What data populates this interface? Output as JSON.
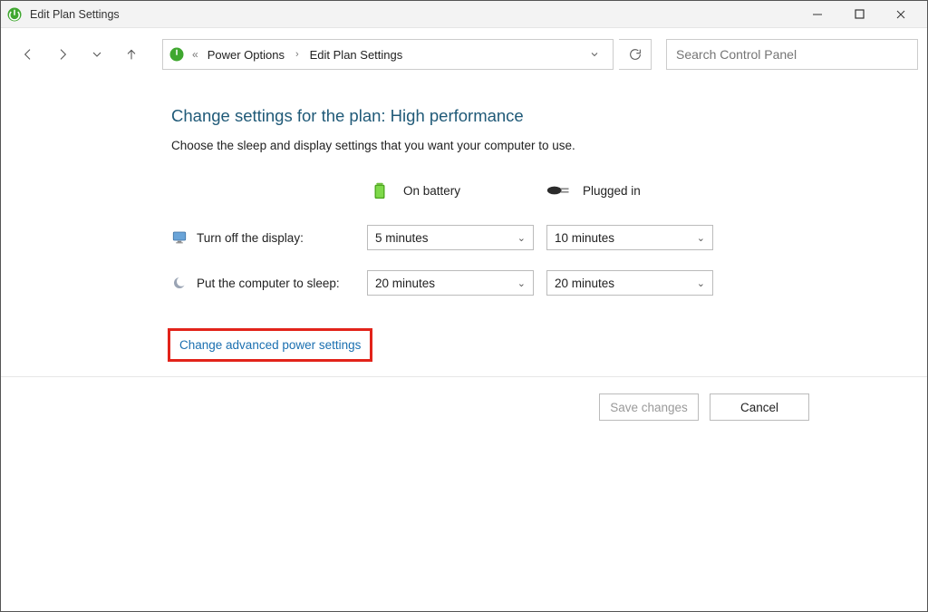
{
  "window": {
    "title": "Edit Plan Settings"
  },
  "breadcrumbs": {
    "item1": "Power Options",
    "item2": "Edit Plan Settings"
  },
  "search": {
    "placeholder": "Search Control Panel"
  },
  "page": {
    "heading": "Change settings for the plan: High performance",
    "subtext": "Choose the sleep and display settings that you want your computer to use."
  },
  "columns": {
    "battery": "On battery",
    "plugged": "Plugged in"
  },
  "rows": {
    "display_label": "Turn off the display:",
    "display_battery": "5 minutes",
    "display_plugged": "10 minutes",
    "sleep_label": "Put the computer to sleep:",
    "sleep_battery": "20 minutes",
    "sleep_plugged": "20 minutes"
  },
  "advanced_link": "Change advanced power settings",
  "buttons": {
    "save": "Save changes",
    "cancel": "Cancel"
  }
}
